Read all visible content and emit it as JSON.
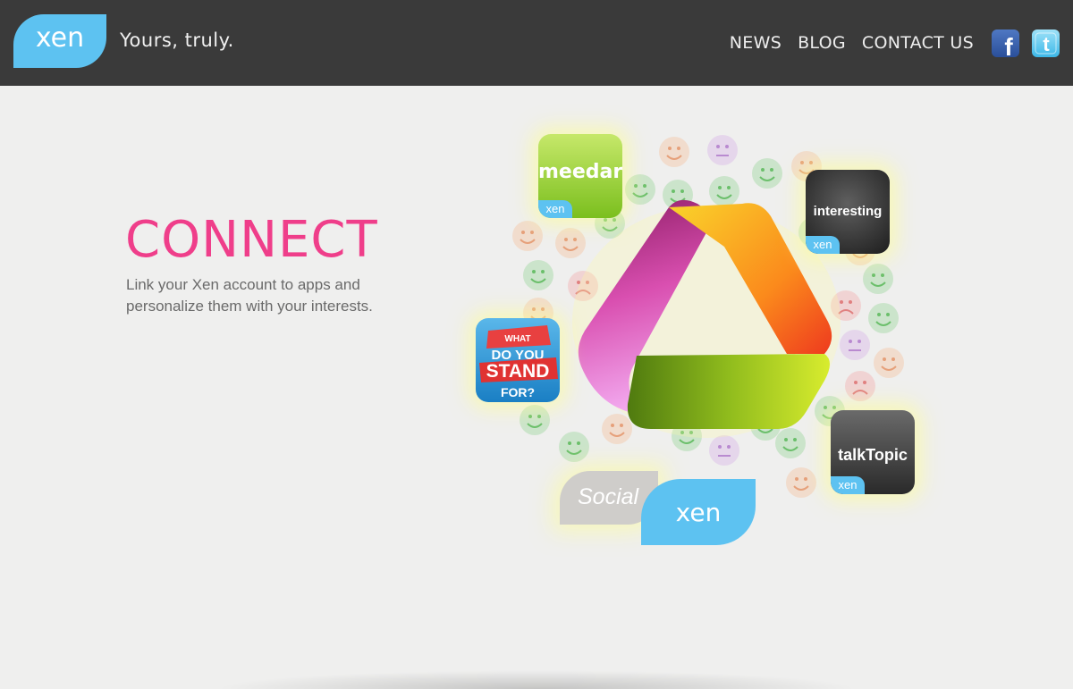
{
  "header": {
    "logo_text": "xen",
    "tagline": "Yours, truly.",
    "nav": [
      "NEWS",
      "BLOG",
      "CONTACT US"
    ],
    "social": [
      {
        "name": "facebook-icon",
        "glyph": "f"
      },
      {
        "name": "twitter-icon",
        "glyph": "t"
      }
    ]
  },
  "hero": {
    "headline": "CONNECT",
    "description": "Link your Xen account to apps and personalize them with your interests."
  },
  "illustration": {
    "apps": [
      {
        "name": "meedar",
        "badge": "xen"
      },
      {
        "name": "interesting",
        "badge": "xen"
      },
      {
        "name": "talkTopic",
        "badge": "xen"
      }
    ],
    "wdys_text": [
      "WHAT",
      "DO YOU",
      "STAND",
      "FOR?"
    ],
    "social_xen": {
      "left": "Social",
      "right": "xen"
    }
  },
  "colors": {
    "header_bg": "#3a3a3a",
    "accent_blue": "#5dc2f1",
    "headline_pink": "#ef3e8a"
  }
}
